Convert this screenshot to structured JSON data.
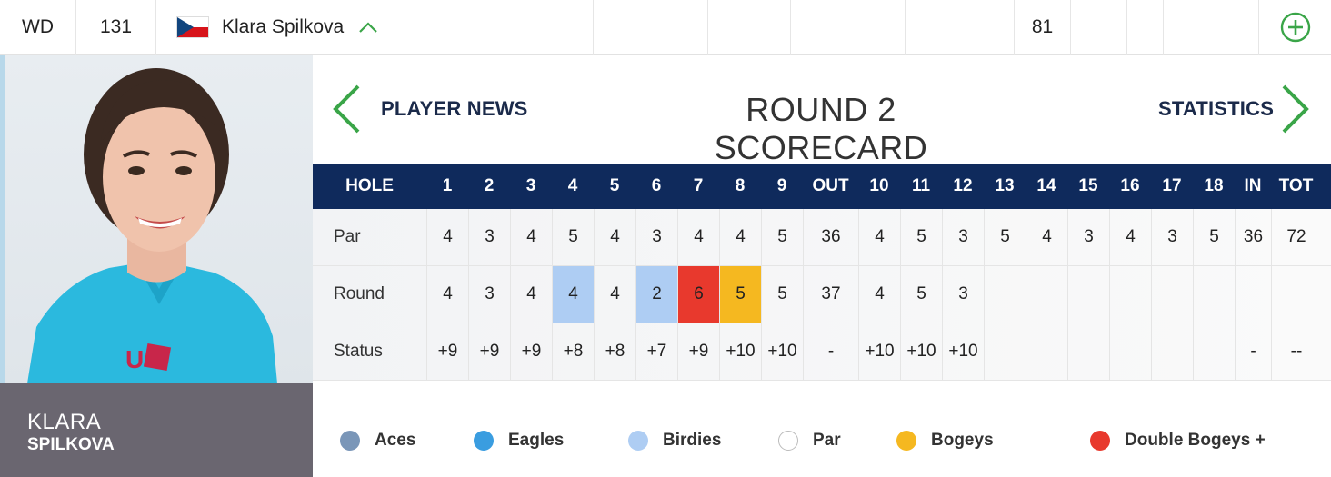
{
  "top": {
    "status": "WD",
    "score": "131",
    "player_name": "Klara Spilkova",
    "total_col": "81",
    "flag_icon": "czech-flag-icon",
    "expand_icon": "chevron-up-icon",
    "add_icon": "plus-circle-icon"
  },
  "player": {
    "first_name": "KLARA",
    "last_name": "SPILKOVA"
  },
  "nav": {
    "left_label": "PLAYER NEWS",
    "right_label": "STATISTICS",
    "title": "ROUND 2 SCORECARD"
  },
  "table": {
    "headers": [
      "HOLE",
      "1",
      "2",
      "3",
      "4",
      "5",
      "6",
      "7",
      "8",
      "9",
      "OUT",
      "10",
      "11",
      "12",
      "13",
      "14",
      "15",
      "16",
      "17",
      "18",
      "IN",
      "TOT"
    ],
    "rows": [
      {
        "label": "Par",
        "cells": [
          "4",
          "3",
          "4",
          "5",
          "4",
          "3",
          "4",
          "4",
          "5",
          "36",
          "4",
          "5",
          "3",
          "5",
          "4",
          "3",
          "4",
          "3",
          "5",
          "36",
          "72"
        ]
      },
      {
        "label": "Round",
        "cells": [
          "4",
          "3",
          "4",
          "4",
          "4",
          "2",
          "6",
          "5",
          "5",
          "37",
          "4",
          "5",
          "3",
          "",
          "",
          "",
          "",
          "",
          "",
          "",
          ""
        ]
      },
      {
        "label": "Status",
        "cells": [
          "+9",
          "+9",
          "+9",
          "+8",
          "+8",
          "+7",
          "+9",
          "+10",
          "+10",
          "-",
          "+10",
          "+10",
          "+10",
          "",
          "",
          "",
          "",
          "",
          "",
          "-",
          "--"
        ]
      }
    ],
    "round_highlights": {
      "3": "#aecdf3",
      "5": "#aecdf3",
      "6": "#e8392d",
      "7": "#f5b820"
    }
  },
  "legend": [
    {
      "label": "Aces",
      "color": "#7a96b8"
    },
    {
      "label": "Eagles",
      "color": "#3a9de0"
    },
    {
      "label": "Birdies",
      "color": "#aecdf3"
    },
    {
      "label": "Par",
      "color": "#ffffff"
    },
    {
      "label": "Bogeys",
      "color": "#f5b820"
    },
    {
      "label": "Double Bogeys +",
      "color": "#e8392d"
    }
  ],
  "colors": {
    "header_bg": "#0f2a5c",
    "accent_green": "#3aa548",
    "name_panel": "#6a6670"
  }
}
